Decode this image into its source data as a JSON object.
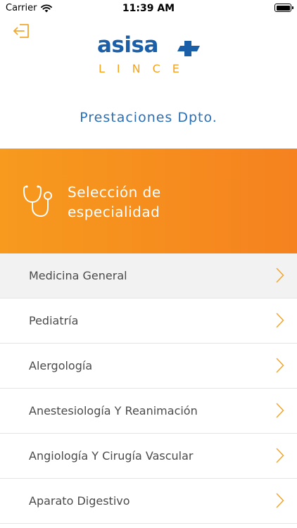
{
  "status_bar": {
    "carrier": "Carrier",
    "time": "11:39 AM"
  },
  "header": {
    "logo_word": "asisa",
    "logo_sub": "LINCE",
    "subtitle": "Prestaciones Dpto."
  },
  "banner": {
    "icon": "stethoscope-icon",
    "title_line1": "Selección de",
    "title_line2": "especialidad"
  },
  "specialties": [
    {
      "label": "Medicina General",
      "selected": true
    },
    {
      "label": "Pediatría",
      "selected": false
    },
    {
      "label": "Alergología",
      "selected": false
    },
    {
      "label": "Anestesiología Y Reanimación",
      "selected": false
    },
    {
      "label": "Angiología Y Cirugía Vascular",
      "selected": false
    },
    {
      "label": "Aparato Digestivo",
      "selected": false
    }
  ],
  "colors": {
    "brand_blue": "#1b5fa8",
    "accent_orange": "#f5821f",
    "chevron": "#f0a830"
  }
}
